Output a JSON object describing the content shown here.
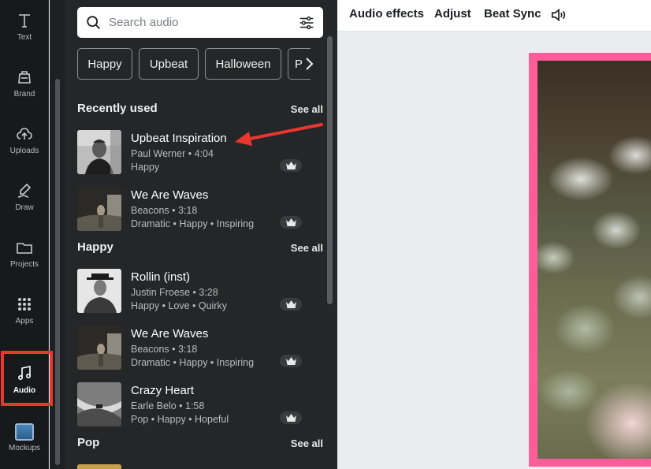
{
  "rail": {
    "items": [
      {
        "label": "Text",
        "icon": "text-icon"
      },
      {
        "label": "Brand",
        "icon": "brand-icon"
      },
      {
        "label": "Uploads",
        "icon": "upload-cloud-icon"
      },
      {
        "label": "Draw",
        "icon": "draw-icon"
      },
      {
        "label": "Projects",
        "icon": "folder-icon"
      },
      {
        "label": "Apps",
        "icon": "apps-grid-icon"
      },
      {
        "label": "Audio",
        "icon": "music-note-icon"
      },
      {
        "label": "Mockups",
        "icon": "mockups-icon"
      }
    ],
    "active": "Audio",
    "highlight_color": "#e8372f"
  },
  "search": {
    "placeholder": "Search audio",
    "value": ""
  },
  "chips": [
    "Happy",
    "Upbeat",
    "Halloween",
    "P"
  ],
  "sections": {
    "recently_used": {
      "title": "Recently used",
      "see_all": "See all",
      "tracks": [
        {
          "title": "Upbeat Inspiration",
          "artist": "Paul Werner",
          "duration": "4:04",
          "meta": "Paul Werner • 4:04",
          "tags": "Happy"
        },
        {
          "title": "We Are Waves",
          "artist": "Beacons",
          "duration": "3:18",
          "meta": "Beacons • 3:18",
          "tags": "Dramatic • Happy • Inspiring"
        }
      ]
    },
    "happy": {
      "title": "Happy",
      "see_all": "See all",
      "tracks": [
        {
          "title": "Rollin (inst)",
          "artist": "Justin Froese",
          "duration": "3:28",
          "meta": "Justin Froese • 3:28",
          "tags": "Happy • Love • Quirky"
        },
        {
          "title": "We Are Waves",
          "artist": "Beacons",
          "duration": "3:18",
          "meta": "Beacons • 3:18",
          "tags": "Dramatic • Happy • Inspiring"
        },
        {
          "title": "Crazy Heart",
          "artist": "Earle Belo",
          "duration": "1:58",
          "meta": "Earle Belo • 1:58",
          "tags": "Pop • Happy • Hopeful"
        }
      ]
    },
    "pop": {
      "title": "Pop",
      "see_all": "See all"
    }
  },
  "toolbar": {
    "audio_effects": "Audio effects",
    "adjust": "Adjust",
    "beat_sync": "Beat Sync",
    "speaker_icon": "speaker-icon"
  },
  "colors": {
    "panel_bg": "#252627",
    "rail_bg": "#18191b",
    "frame_pink": "#ff5c9a",
    "annotation_red": "#e8372f"
  }
}
